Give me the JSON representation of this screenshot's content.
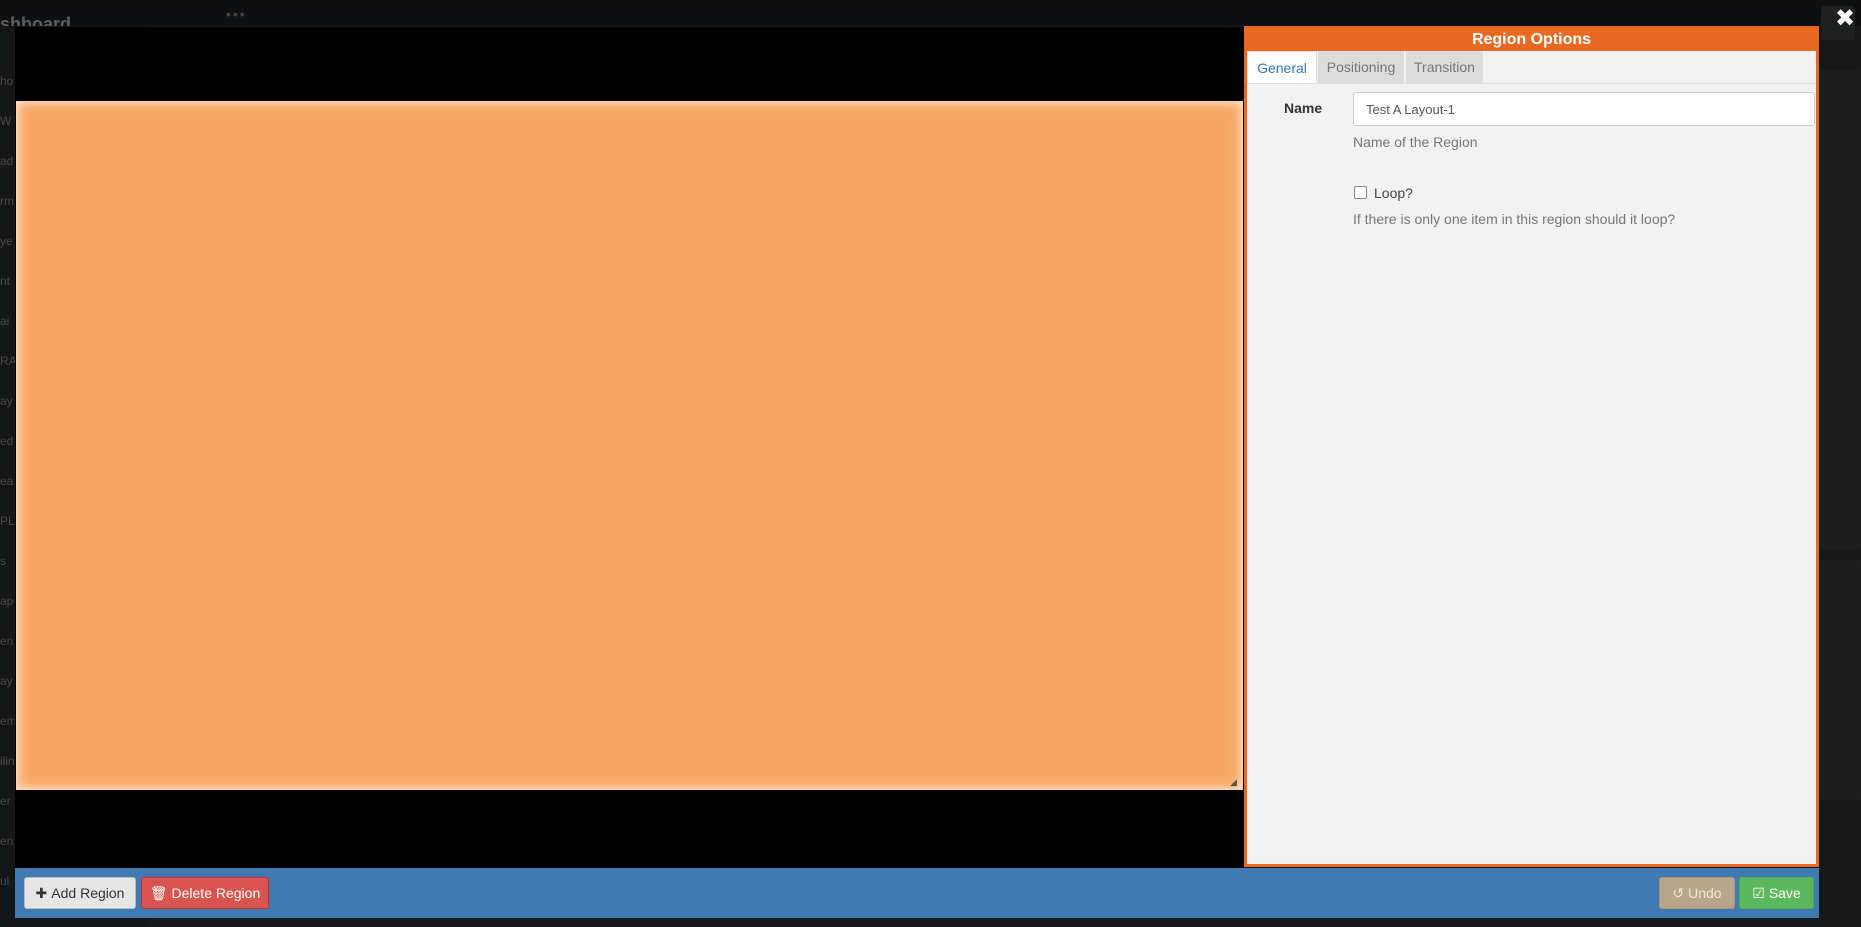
{
  "background": {
    "title": "shboard",
    "sidebar_fragments": [
      "ho",
      "W",
      "ad",
      "rm",
      "ye",
      "nt",
      "ai",
      "RA",
      "ay",
      "ed",
      "ea",
      "PL",
      "s",
      "ap",
      "en",
      "ay",
      "em",
      "ilin",
      "er",
      "en",
      "ul"
    ]
  },
  "region_options": {
    "title": "Region Options",
    "tabs": [
      {
        "label": "General",
        "active": true
      },
      {
        "label": "Positioning",
        "active": false
      },
      {
        "label": "Transition",
        "active": false
      }
    ],
    "name_label": "Name",
    "name_value": "Test A Layout-1",
    "name_help": "Name of the Region",
    "loop_label": "Loop?",
    "loop_checked": false,
    "loop_help": "If there is only one item in this region should it loop?"
  },
  "toolbar": {
    "add_region_label": "Add Region",
    "delete_region_label": "Delete Region",
    "undo_label": "Undo",
    "save_label": "Save"
  },
  "icons": {
    "add": "plus-icon",
    "delete": "trash-icon",
    "undo": "undo-icon",
    "save": "check-square-icon",
    "close": "close-icon",
    "resize": "resize-handle-icon"
  },
  "colors": {
    "region_fill": "#f8a663",
    "panel_accent": "#e96923",
    "toolbar": "#3f7ab3",
    "delete": "#d9534f",
    "save": "#5cb85c",
    "undo": "#b8a68a"
  }
}
